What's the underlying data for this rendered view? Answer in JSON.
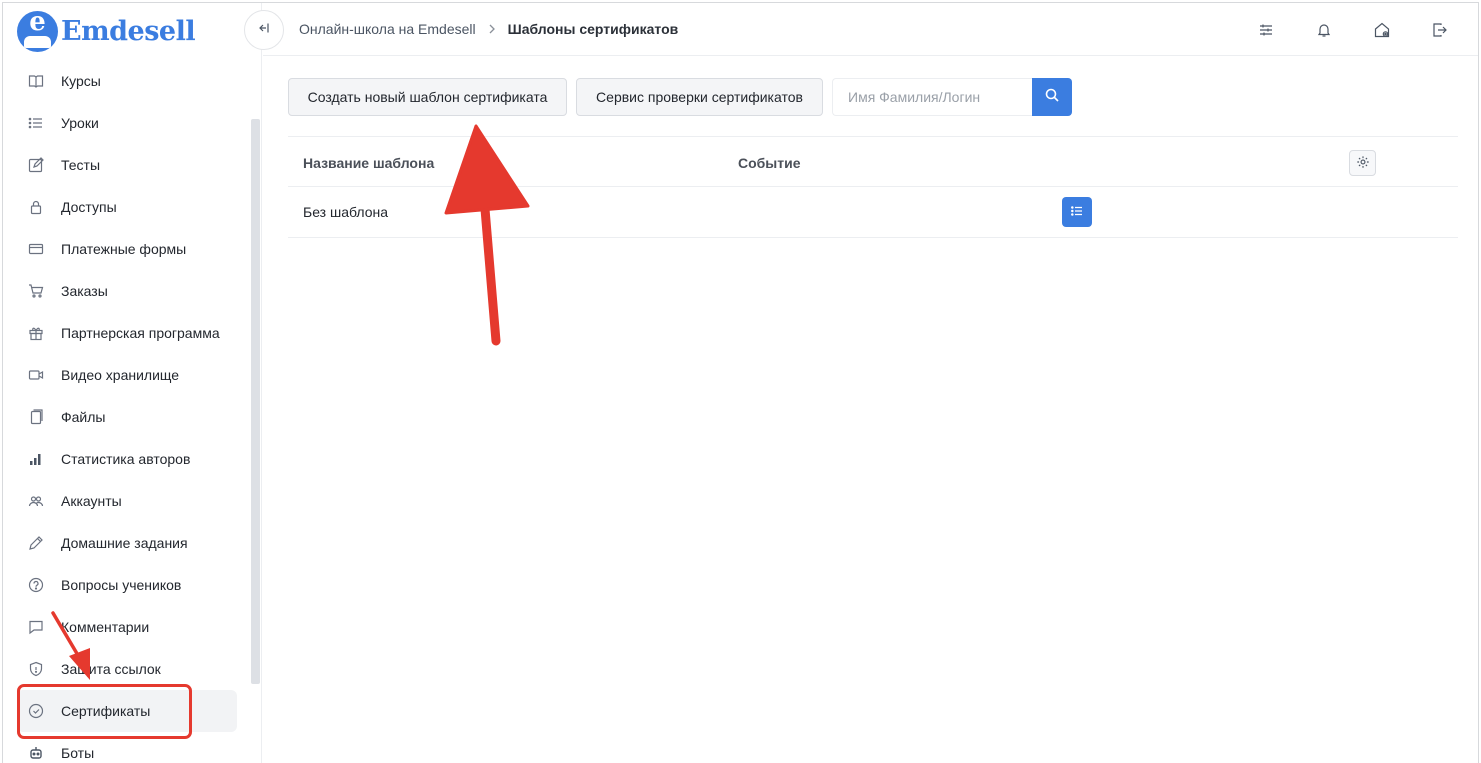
{
  "brand": {
    "name": "Emdesell",
    "logo_letter": "e",
    "color": "#3b7de0"
  },
  "sidebar": {
    "items": [
      {
        "label": "Курсы",
        "icon": "book-icon"
      },
      {
        "label": "Уроки",
        "icon": "list-icon"
      },
      {
        "label": "Тесты",
        "icon": "edit-square-icon"
      },
      {
        "label": "Доступы",
        "icon": "lock-icon"
      },
      {
        "label": "Платежные формы",
        "icon": "credit-card-icon"
      },
      {
        "label": "Заказы",
        "icon": "cart-icon"
      },
      {
        "label": "Партнерская программа",
        "icon": "gift-icon"
      },
      {
        "label": "Видео хранилище",
        "icon": "video-icon"
      },
      {
        "label": "Файлы",
        "icon": "file-icon"
      },
      {
        "label": "Статистика авторов",
        "icon": "bar-chart-icon"
      },
      {
        "label": "Аккаунты",
        "icon": "users-icon"
      },
      {
        "label": "Домашние задания",
        "icon": "pencil-icon"
      },
      {
        "label": "Вопросы учеников",
        "icon": "question-circle-icon"
      },
      {
        "label": "Комментарии",
        "icon": "comment-icon"
      },
      {
        "label": "Защита ссылок",
        "icon": "shield-icon"
      },
      {
        "label": "Сертификаты",
        "icon": "check-circle-icon",
        "active": true
      },
      {
        "label": "Боты",
        "icon": "robot-icon"
      }
    ]
  },
  "header": {
    "breadcrumb": {
      "root": "Онлайн-школа на Emdesell",
      "current": "Шаблоны сертификатов"
    },
    "icons": [
      "sliders-icon",
      "bell-icon",
      "home-settings-icon",
      "logout-icon"
    ]
  },
  "toolbar": {
    "create_label": "Создать новый шаблон сертификата",
    "check_service_label": "Сервис проверки сертификатов",
    "search_placeholder": "Имя Фамилия/Логин"
  },
  "table": {
    "columns": [
      "Название шаблона",
      "Событие"
    ],
    "rows": [
      {
        "name": "Без шаблона",
        "event": ""
      }
    ]
  },
  "annotations": {
    "color": "#e5392e"
  }
}
